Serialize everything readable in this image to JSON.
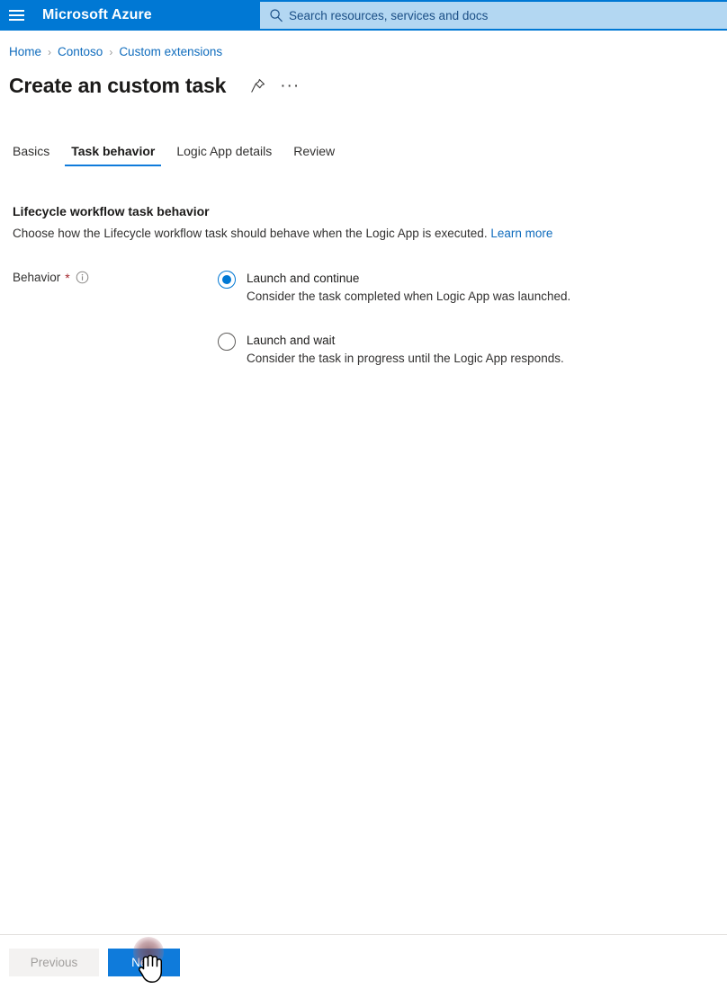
{
  "topbar": {
    "menu_icon": "hamburger-icon",
    "brand": "Microsoft Azure",
    "search": {
      "icon": "search-icon",
      "placeholder": "Search resources, services and docs",
      "value": ""
    },
    "background_color": "#0078d4",
    "search_background_color": "#b3d7f2"
  },
  "breadcrumb": {
    "items": [
      {
        "label": "Home"
      },
      {
        "label": "Contoso"
      },
      {
        "label": "Custom extensions"
      }
    ],
    "separator": "›",
    "link_color": "#0f6cbd"
  },
  "header": {
    "title": "Create an custom task",
    "pin_icon": "pin-icon",
    "more_icon": "ellipsis-icon",
    "more_label": "···"
  },
  "tabs": [
    {
      "label": "Basics",
      "active": false
    },
    {
      "label": "Task behavior",
      "active": true
    },
    {
      "label": "Logic App details",
      "active": false
    },
    {
      "label": "Review",
      "active": false
    }
  ],
  "active_tab_underline_color": "#0f7bdb",
  "form": {
    "section_heading": "Lifecycle workflow task behavior",
    "section_description": "Choose how the Lifecycle workflow task should behave when the Logic App is executed.",
    "learn_more_label": "Learn more",
    "field": {
      "label": "Behavior",
      "required_marker": "*",
      "required_color": "#a4262c",
      "info_icon": "info-circle-icon"
    },
    "options": [
      {
        "title": "Launch and continue",
        "description": "Consider the task completed when Logic App was launched.",
        "selected": true
      },
      {
        "title": "Launch and wait",
        "description": "Consider the task in progress until the Logic App responds.",
        "selected": false
      }
    ],
    "selected_color": "#0078d4"
  },
  "footer": {
    "previous_label": "Previous",
    "previous_enabled": false,
    "next_label": "Next",
    "next_color": "#0f7bdb"
  },
  "pointer": {
    "cursor_type": "hand-pointer",
    "click_indicator": true
  }
}
